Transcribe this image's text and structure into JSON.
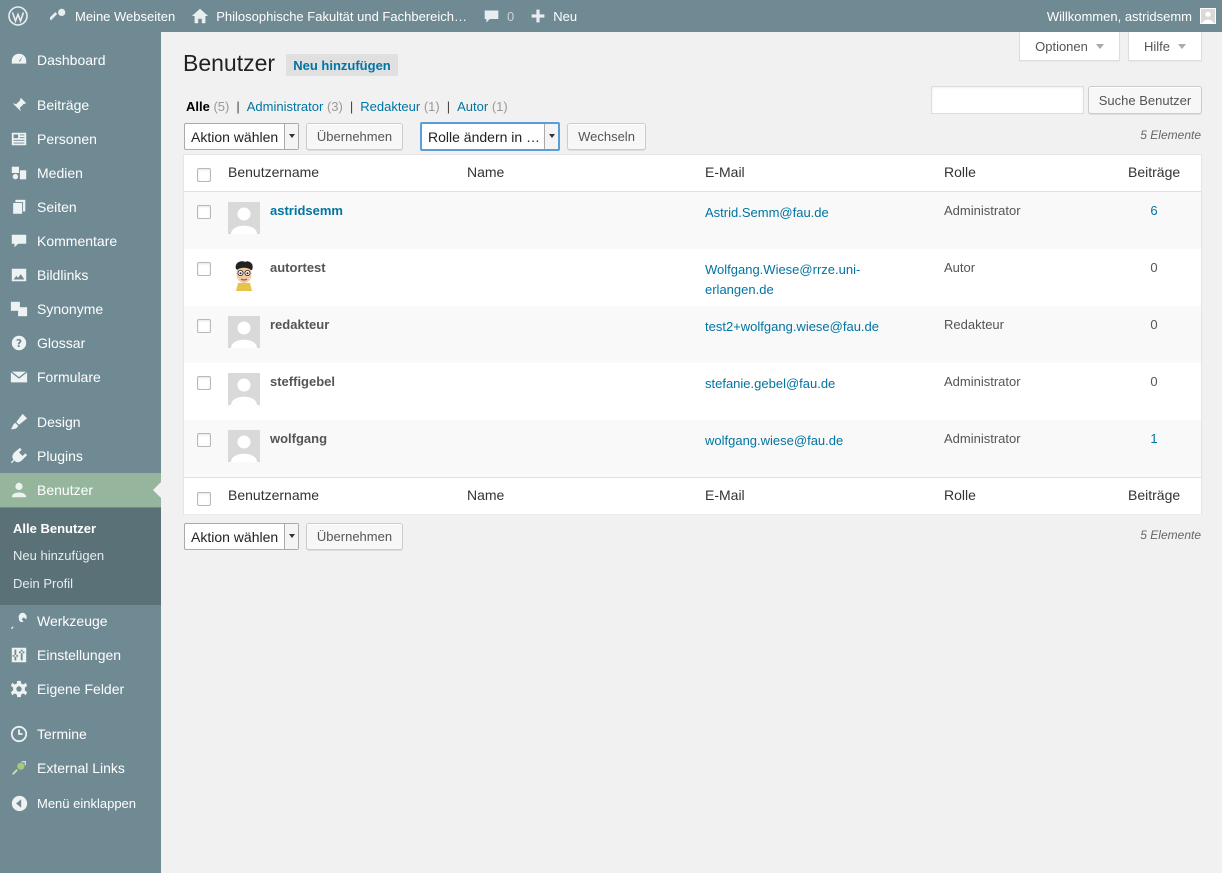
{
  "adminbar": {
    "my_sites": "Meine Webseiten",
    "site_name": "Philosophische Fakultät und Fachbereich…",
    "comments_count": "0",
    "new_label": "Neu",
    "greeting": "Willkommen, astridsemm"
  },
  "sidebar": {
    "items": [
      {
        "label": "Dashboard",
        "icon": "dashboard-icon"
      },
      {
        "label": "Beiträge",
        "icon": "pushpin-icon"
      },
      {
        "label": "Personen",
        "icon": "id-card-icon"
      },
      {
        "label": "Medien",
        "icon": "media-icon"
      },
      {
        "label": "Seiten",
        "icon": "pages-icon"
      },
      {
        "label": "Kommentare",
        "icon": "comment-icon"
      },
      {
        "label": "Bildlinks",
        "icon": "image-icon"
      },
      {
        "label": "Synonyme",
        "icon": "translation-icon"
      },
      {
        "label": "Glossar",
        "icon": "help-icon"
      },
      {
        "label": "Formulare",
        "icon": "envelope-icon"
      },
      {
        "label": "Design",
        "icon": "brush-icon"
      },
      {
        "label": "Plugins",
        "icon": "plug-icon"
      },
      {
        "label": "Benutzer",
        "icon": "user-icon"
      },
      {
        "label": "Werkzeuge",
        "icon": "wrench-icon"
      },
      {
        "label": "Einstellungen",
        "icon": "settings-sliders-icon"
      },
      {
        "label": "Eigene Felder",
        "icon": "gear-icon"
      },
      {
        "label": "Termine",
        "icon": "clock-icon"
      },
      {
        "label": "External Links",
        "icon": "external-link-icon"
      },
      {
        "label": "Menü einklappen",
        "icon": "collapse-arrow-icon"
      }
    ],
    "submenu": [
      "Alle Benutzer",
      "Neu hinzufügen",
      "Dein Profil"
    ]
  },
  "screen_options": {
    "options": "Optionen",
    "help": "Hilfe"
  },
  "page": {
    "title": "Benutzer",
    "add_new": "Neu hinzufügen"
  },
  "filters": [
    {
      "label": "Alle",
      "count": "(5)"
    },
    {
      "label": "Administrator",
      "count": "(3)"
    },
    {
      "label": "Redakteur",
      "count": "(1)"
    },
    {
      "label": "Autor",
      "count": "(1)"
    }
  ],
  "search": {
    "button": "Suche Benutzer",
    "value": ""
  },
  "bulk": {
    "action_select": "Aktion wählen",
    "apply": "Übernehmen",
    "role_select": "Rolle ändern in …",
    "change": "Wechseln",
    "count": "5 Elemente"
  },
  "table": {
    "columns": [
      "Benutzername",
      "Name",
      "E-Mail",
      "Rolle",
      "Beiträge"
    ],
    "rows": [
      {
        "username": "astridsemm",
        "name": "",
        "email": "Astrid.Semm@fau.de",
        "email_line2": "",
        "role": "Administrator",
        "posts": "6"
      },
      {
        "username": "autortest",
        "name": "",
        "email": "Wolfgang.Wiese@rrze.uni-",
        "email_line2": "erlangen.de",
        "role": "Autor",
        "posts": "0"
      },
      {
        "username": "redakteur",
        "name": "",
        "email": "test2+wolfgang.wiese@fau.de",
        "email_line2": "",
        "role": "Redakteur",
        "posts": "0"
      },
      {
        "username": "steffigebel",
        "name": "",
        "email": "stefanie.gebel@fau.de",
        "email_line2": "",
        "role": "Administrator",
        "posts": "0"
      },
      {
        "username": "wolfgang",
        "name": "",
        "email": "wolfgang.wiese@fau.de",
        "email_line2": "",
        "role": "Administrator",
        "posts": "1"
      }
    ]
  },
  "colors": {
    "sidebar": "#6f8a93",
    "active": "#95b69c",
    "link": "#0074a2",
    "submenu": "#5a7178"
  }
}
